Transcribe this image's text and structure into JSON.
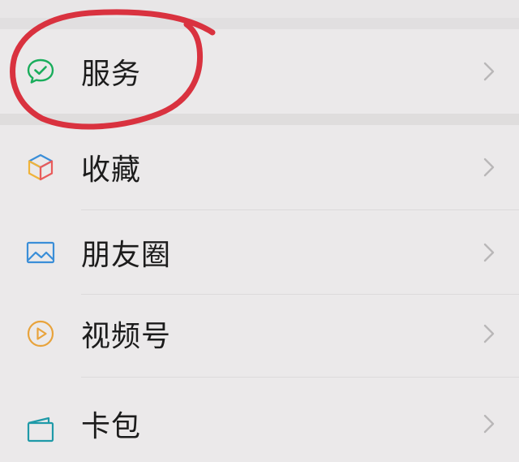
{
  "menu": {
    "items": [
      {
        "key": "services",
        "label": "服务",
        "icon": "chat-check-icon",
        "color": "#1aad5c"
      },
      {
        "key": "favorites",
        "label": "收藏",
        "icon": "cube-icon",
        "color": "#e95b5b"
      },
      {
        "key": "moments",
        "label": "朋友圈",
        "icon": "image-icon",
        "color": "#3a8ed8"
      },
      {
        "key": "channels",
        "label": "视频号",
        "icon": "play-circle-icon",
        "color": "#e8a33c"
      },
      {
        "key": "cards",
        "label": "卡包",
        "icon": "wallet-icon",
        "color": "#1f9aa8"
      }
    ]
  },
  "annotation": {
    "color": "#d9323f",
    "target": "services"
  }
}
